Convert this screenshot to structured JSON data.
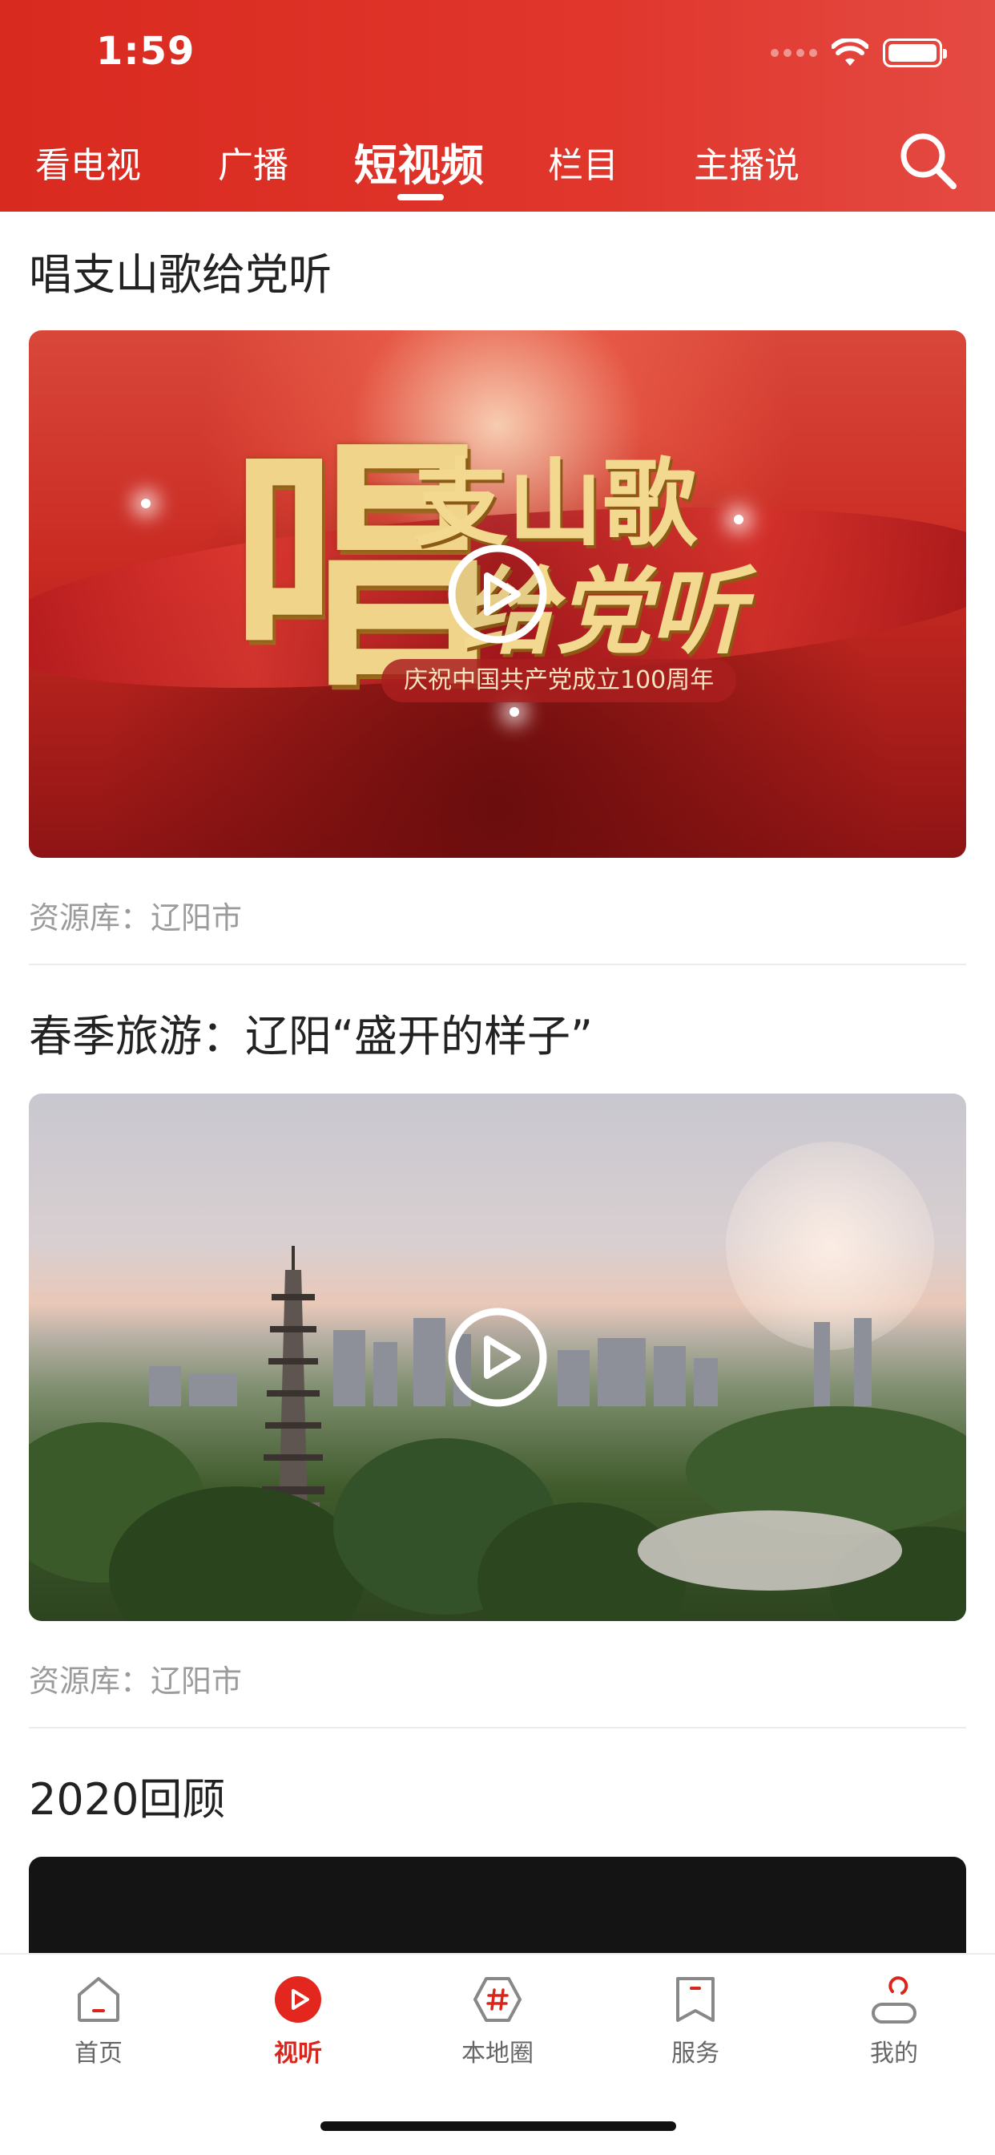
{
  "status_bar": {
    "time": "1:59"
  },
  "nav": {
    "tabs": [
      {
        "label": "看电视"
      },
      {
        "label": "广播"
      },
      {
        "label": "短视频",
        "active": true
      },
      {
        "label": "栏目"
      },
      {
        "label": "主播说"
      }
    ],
    "search_icon": "search-icon"
  },
  "feed": {
    "items": [
      {
        "title": "唱支山歌给党听",
        "thumbnail_text": {
          "big": "唱",
          "line1": "支山歌",
          "line2": "给党听",
          "caption": "庆祝中国共产党成立100周年"
        },
        "source_label": "资源库：",
        "source_value": "辽阳市"
      },
      {
        "title": "春季旅游：辽阳“盛开的样子”",
        "source_label": "资源库：",
        "source_value": "辽阳市"
      },
      {
        "title": "2020回顾"
      }
    ]
  },
  "tabbar": {
    "items": [
      {
        "label": "首页",
        "icon": "home-icon"
      },
      {
        "label": "视听",
        "icon": "play-circle-icon",
        "active": true
      },
      {
        "label": "本地圈",
        "icon": "hashtag-icon"
      },
      {
        "label": "服务",
        "icon": "bookmark-icon"
      },
      {
        "label": "我的",
        "icon": "user-icon"
      }
    ]
  },
  "colors": {
    "brand_red": "#d9261c",
    "text_dark": "#222222",
    "text_muted": "#9b9b9b"
  }
}
